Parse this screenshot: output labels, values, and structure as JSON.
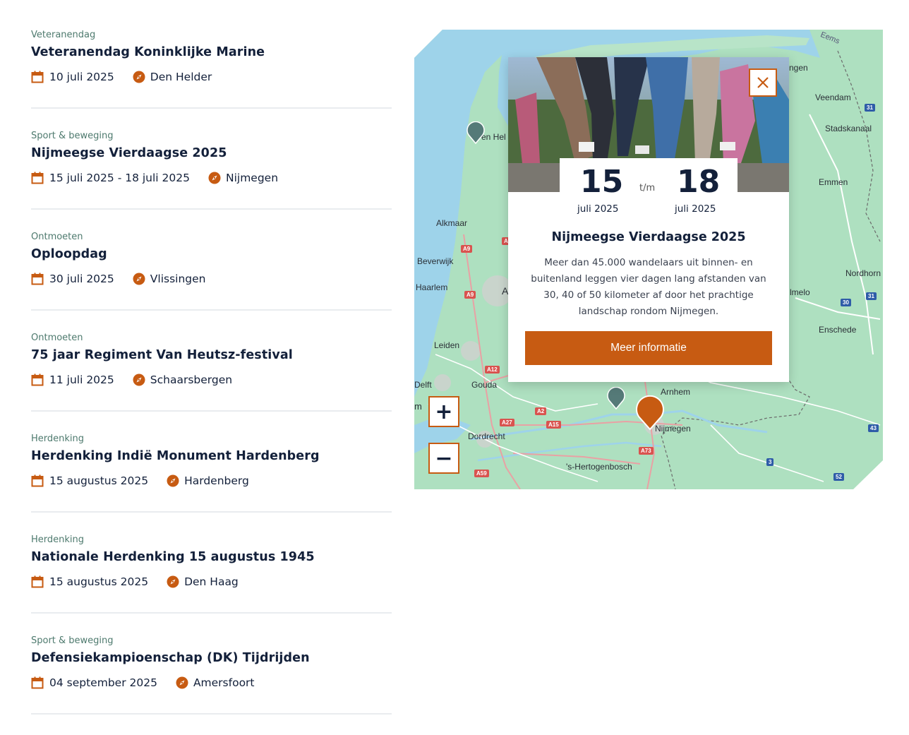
{
  "events": [
    {
      "category": "Veteranendag",
      "title": "Veteranendag Koninklijke Marine",
      "date": "10 juli 2025",
      "location": "Den Helder"
    },
    {
      "category": "Sport & beweging",
      "title": "Nijmeegse Vierdaagse 2025",
      "date": "15 juli 2025 - 18 juli 2025",
      "location": "Nijmegen"
    },
    {
      "category": "Ontmoeten",
      "title": "Oploopdag",
      "date": "30 juli 2025",
      "location": "Vlissingen"
    },
    {
      "category": "Ontmoeten",
      "title": "75 jaar Regiment Van Heutsz-festival",
      "date": "11 juli 2025",
      "location": "Schaarsbergen"
    },
    {
      "category": "Herdenking",
      "title": "Herdenking Indië Monument Hardenberg",
      "date": "15 augustus 2025",
      "location": "Hardenberg"
    },
    {
      "category": "Herdenking",
      "title": "Nationale Herdenking 15 augustus 1945",
      "date": "15 augustus 2025",
      "location": "Den Haag"
    },
    {
      "category": "Sport & beweging",
      "title": "Defensiekampioenschap (DK) Tijdrijden",
      "date": "04 september 2025",
      "location": "Amersfoort"
    }
  ],
  "popup": {
    "start_day": "15",
    "start_month": "juli 2025",
    "separator": "t/m",
    "end_day": "18",
    "end_month": "juli 2025",
    "title": "Nijmeegse Vierdaagse 2025",
    "description": "Meer dan 45.000 wandelaars uit binnen- en buitenland leggen vier dagen lang afstanden van 30, 40 of 50 kilometer af door het prachtige landschap rondom Nijmegen.",
    "button": "Meer informatie",
    "close_symbol": "✕"
  },
  "map": {
    "zoom_in": "+",
    "zoom_out": "−",
    "places": {
      "eems": "Eems",
      "ngen": "ngen",
      "veendam": "Veendam",
      "stadskanaal": "Stadskanaal",
      "emmen": "Emmen",
      "nordhorn": "Nordhorn",
      "imelo": "lmelo",
      "enschede": "Enschede",
      "den_helder": "en Hel",
      "alkmaar": "Alkmaar",
      "beverwijk": "Beverwijk",
      "haarlem": "Haarlem",
      "a_label": "A",
      "leiden": "Leiden",
      "delft": "Delft",
      "gouda": "Gouda",
      "m_label": "m",
      "dordrecht": "Dordrecht",
      "arnhem": "Arnhem",
      "nijmegen": "Nijmegen",
      "den_bosch": "'s-Hertogenbosch"
    },
    "roads": {
      "a9a": "A9",
      "a9b": "A9",
      "a_partial": "A",
      "a12": "A12",
      "a2": "A2",
      "a27": "A27",
      "a15": "A15",
      "a73": "A73",
      "a59": "A59",
      "n31a": "31",
      "n31b": "31",
      "n30": "30",
      "n43": "43",
      "n3": "3",
      "n52": "52"
    },
    "colors": {
      "land": "#aee0c0",
      "water": "#9ed3ea",
      "active_marker": "#c75b12",
      "inactive_marker": "#557a78"
    }
  }
}
